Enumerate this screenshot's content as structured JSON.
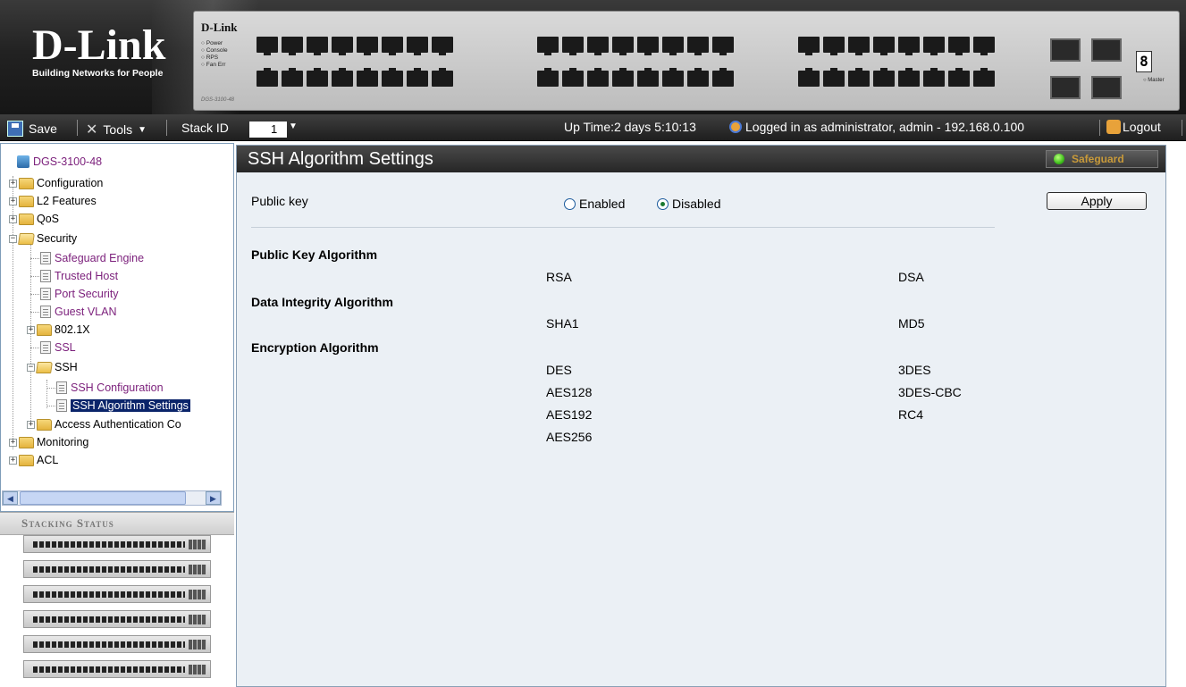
{
  "header": {
    "brand": "D-Link",
    "tagline": "Building Networks for People",
    "panel_logo": "D-Link",
    "panel_leds": [
      "Power",
      "Console",
      "RPS",
      "Fan Err"
    ],
    "model_name": "DGS-3100-48",
    "unit_digit": "8",
    "master_label": "Master"
  },
  "toolbar": {
    "save_label": "Save",
    "tools_label": "Tools",
    "stack_id_label": "Stack ID",
    "stack_id_value": "1",
    "uptime": "Up Time:2 days 5:10:13",
    "login_info": "Logged in as administrator, admin - 192.168.0.100",
    "logout_label": "Logout"
  },
  "tree": {
    "root": "DGS-3100-48",
    "items": [
      {
        "label": "Configuration"
      },
      {
        "label": "L2 Features"
      },
      {
        "label": "QoS"
      },
      {
        "label": "Security"
      },
      {
        "label": "Safeguard Engine"
      },
      {
        "label": "Trusted Host"
      },
      {
        "label": "Port Security"
      },
      {
        "label": "Guest VLAN"
      },
      {
        "label": "802.1X"
      },
      {
        "label": "SSL"
      },
      {
        "label": "SSH"
      },
      {
        "label": "SSH Configuration"
      },
      {
        "label": "SSH Algorithm Settings"
      },
      {
        "label": "Access Authentication Co"
      },
      {
        "label": "Monitoring"
      },
      {
        "label": "ACL"
      }
    ]
  },
  "stacking": {
    "title": "Stacking Status",
    "unit_count": 6
  },
  "main": {
    "title": "SSH Algorithm Settings",
    "safeguard_label": "Safeguard",
    "public_key_label": "Public key",
    "enabled_label": "Enabled",
    "disabled_label": "Disabled",
    "public_key_state": "Disabled",
    "apply_label": "Apply",
    "sections": [
      {
        "heading": "Public Key Algorithm",
        "left": [
          "RSA"
        ],
        "right": [
          "DSA"
        ]
      },
      {
        "heading": "Data Integrity Algorithm",
        "left": [
          "SHA1"
        ],
        "right": [
          "MD5"
        ]
      },
      {
        "heading": "Encryption Algorithm",
        "left": [
          "DES",
          "AES128",
          "AES192",
          "AES256"
        ],
        "right": [
          "3DES",
          "3DES-CBC",
          "RC4"
        ]
      }
    ]
  },
  "colors": {
    "link_purple": "#7b1f7b",
    "selection": "#0a246a",
    "content_bg": "#ebf0f5",
    "titlebar": "#262626"
  }
}
